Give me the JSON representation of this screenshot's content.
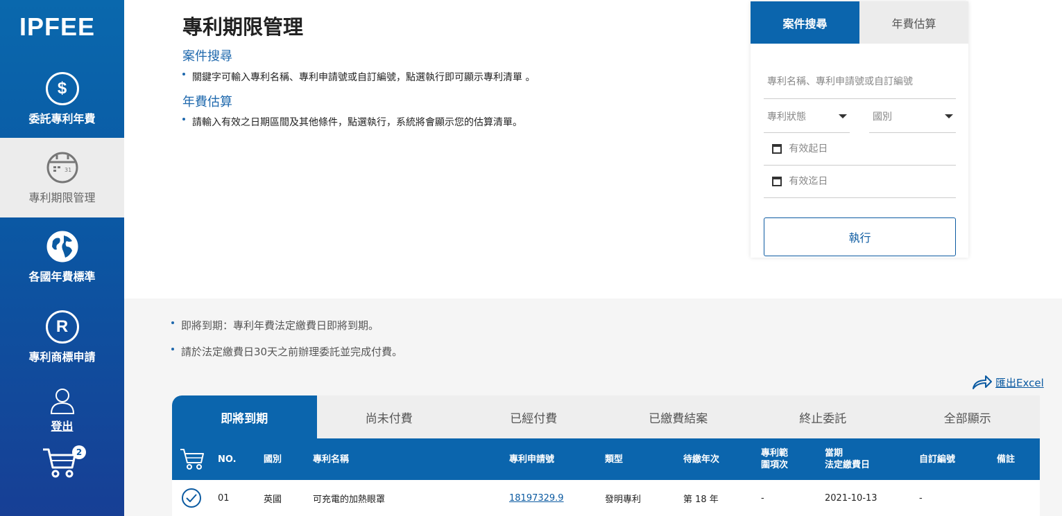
{
  "brand": {
    "logo": "IPFEE"
  },
  "sidebar": {
    "items": [
      {
        "label": "委託專利年費",
        "icon": "dollar-icon"
      },
      {
        "label": "專利期限管理",
        "icon": "calendar-icon",
        "active": true
      },
      {
        "label": "各國年費標準",
        "icon": "globe-icon"
      },
      {
        "label": "專利商標申請",
        "icon": "registered-icon"
      },
      {
        "label": "登出",
        "icon": "user-icon"
      }
    ],
    "cart": {
      "count": "2",
      "icon": "cart-icon"
    }
  },
  "intro": {
    "title": "專利期限管理",
    "search_title": "案件搜尋",
    "search_desc": "關鍵字可輸入專利名稱、專利申請號或自訂編號，點選執行即可顯示專利清單 。",
    "fee_title": "年費估算",
    "fee_desc": "請輸入有效之日期區間及其他條件，點選執行，系統將會顯示您的估算清單。"
  },
  "search_panel": {
    "tabs": [
      "案件搜尋",
      "年費估算"
    ],
    "keyword_placeholder": "專利名稱、專利申請號或自訂編號",
    "status_label": "專利狀態",
    "country_label": "國別",
    "start_date_placeholder": "有效起日",
    "end_date_placeholder": "有效迄日",
    "execute_label": "執行"
  },
  "notes": [
    "即將到期：專利年費法定繳費日即將到期。",
    "請於法定繳費日30天之前辦理委託並完成付費。"
  ],
  "export": {
    "label": "匯出Excel",
    "icon": "share-arrow-icon"
  },
  "list_tabs": [
    "即將到期",
    "尚未付費",
    "已經付費",
    "已繳費結案",
    "終止委託",
    "全部顯示"
  ],
  "table": {
    "headers": {
      "no": "NO.",
      "country": "國別",
      "name": "專利名稱",
      "app_no": "專利申請號",
      "type": "類型",
      "year": "待繳年次",
      "scope_1": "專利範",
      "scope_2": "圍項次",
      "due_1": "當期",
      "due_2": "法定繳費日",
      "custom": "自訂編號",
      "remark": "備註"
    },
    "rows": [
      {
        "no": "01",
        "country": "英國",
        "name": "可充電的加熱眼罩",
        "app_no": "18197329.9",
        "type": "發明專利",
        "year": "第 18 年",
        "scope": "-",
        "due": "2021-10-13",
        "custom": "-",
        "remark": ""
      }
    ]
  },
  "colors": {
    "primary": "#0b65ad",
    "sidebar_bottom": "#173f95",
    "lower_bg": "#f5f5f5"
  }
}
